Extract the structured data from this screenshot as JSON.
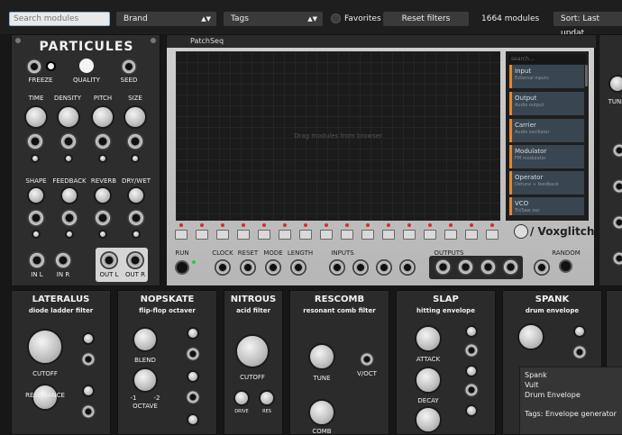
{
  "topbar": {
    "search_placeholder": "Search modules",
    "brand_label": "Brand",
    "tags_label": "Tags",
    "favorites_label": "Favorites",
    "reset_label": "Reset filters",
    "count_label": "1664 modules",
    "sort_label": "Sort: Last updat"
  },
  "particules": {
    "title": "PARTICULES",
    "freeze": "FREEZE",
    "quality": "QUALITY",
    "seed": "SEED",
    "time": "TIME",
    "density": "DENSITY",
    "pitch": "PITCH",
    "size": "SIZE",
    "shape": "SHAPE",
    "feedback": "FEEDBACK",
    "reverb": "REVERB",
    "drywet": "DRY/WET",
    "in_l": "IN L",
    "in_r": "IN R",
    "out_l": "OUT L",
    "out_r": "OUT R"
  },
  "patchseq": {
    "title": "PatchSeq",
    "drag_hint": "Drag modules from browser",
    "search_placeholder": "search...",
    "list": [
      {
        "name": "Input",
        "desc": "External inputs"
      },
      {
        "name": "Output",
        "desc": "Audio output"
      },
      {
        "name": "Carrier",
        "desc": "Audio oscillator"
      },
      {
        "name": "Modulator",
        "desc": "FM modulator"
      },
      {
        "name": "Operator",
        "desc": "Detune + feedback"
      },
      {
        "name": "VCO",
        "desc": "Tri/Saw osc"
      }
    ],
    "run": "RUN",
    "clock": "CLOCK",
    "reset": "RESET",
    "mode": "MODE",
    "length": "LENGTH",
    "inputs": "INPUTS",
    "outputs": "OUTPUTS",
    "random": "RANDOM",
    "brand": "/ Voxglitch"
  },
  "lateralus": {
    "title": "LATERALUS",
    "subtitle": "diode ladder filter",
    "cutoff": "CUTOFF",
    "resonance": "RESONANCE"
  },
  "nopskate": {
    "title": "NOPSKATE",
    "subtitle": "flip-flop octaver",
    "blend": "BLEND",
    "octave": "OCTAVE",
    "minus1": "-1",
    "minus2": "-2"
  },
  "nitrous": {
    "title": "NITROUS",
    "subtitle": "acid filter",
    "cutoff": "CUTOFF",
    "drive": "DRIVE",
    "res": "RES"
  },
  "rescomb": {
    "title": "RESCOMB",
    "subtitle": "resonant comb filter",
    "tune": "TUNE",
    "voct": "V/OCT",
    "comb": "COMB"
  },
  "slap": {
    "title": "SLAP",
    "subtitle": "hitting envelope",
    "attack": "ATTACK",
    "decay": "DECAY"
  },
  "spank": {
    "title": "SPANK",
    "subtitle": "drum envelope"
  },
  "tooltip": {
    "line1": "Spank",
    "line2": "Vult",
    "line3": "Drum Envelope",
    "tags": "Tags: Envelope generator"
  },
  "right_partial": {
    "tune": "TUNI"
  }
}
